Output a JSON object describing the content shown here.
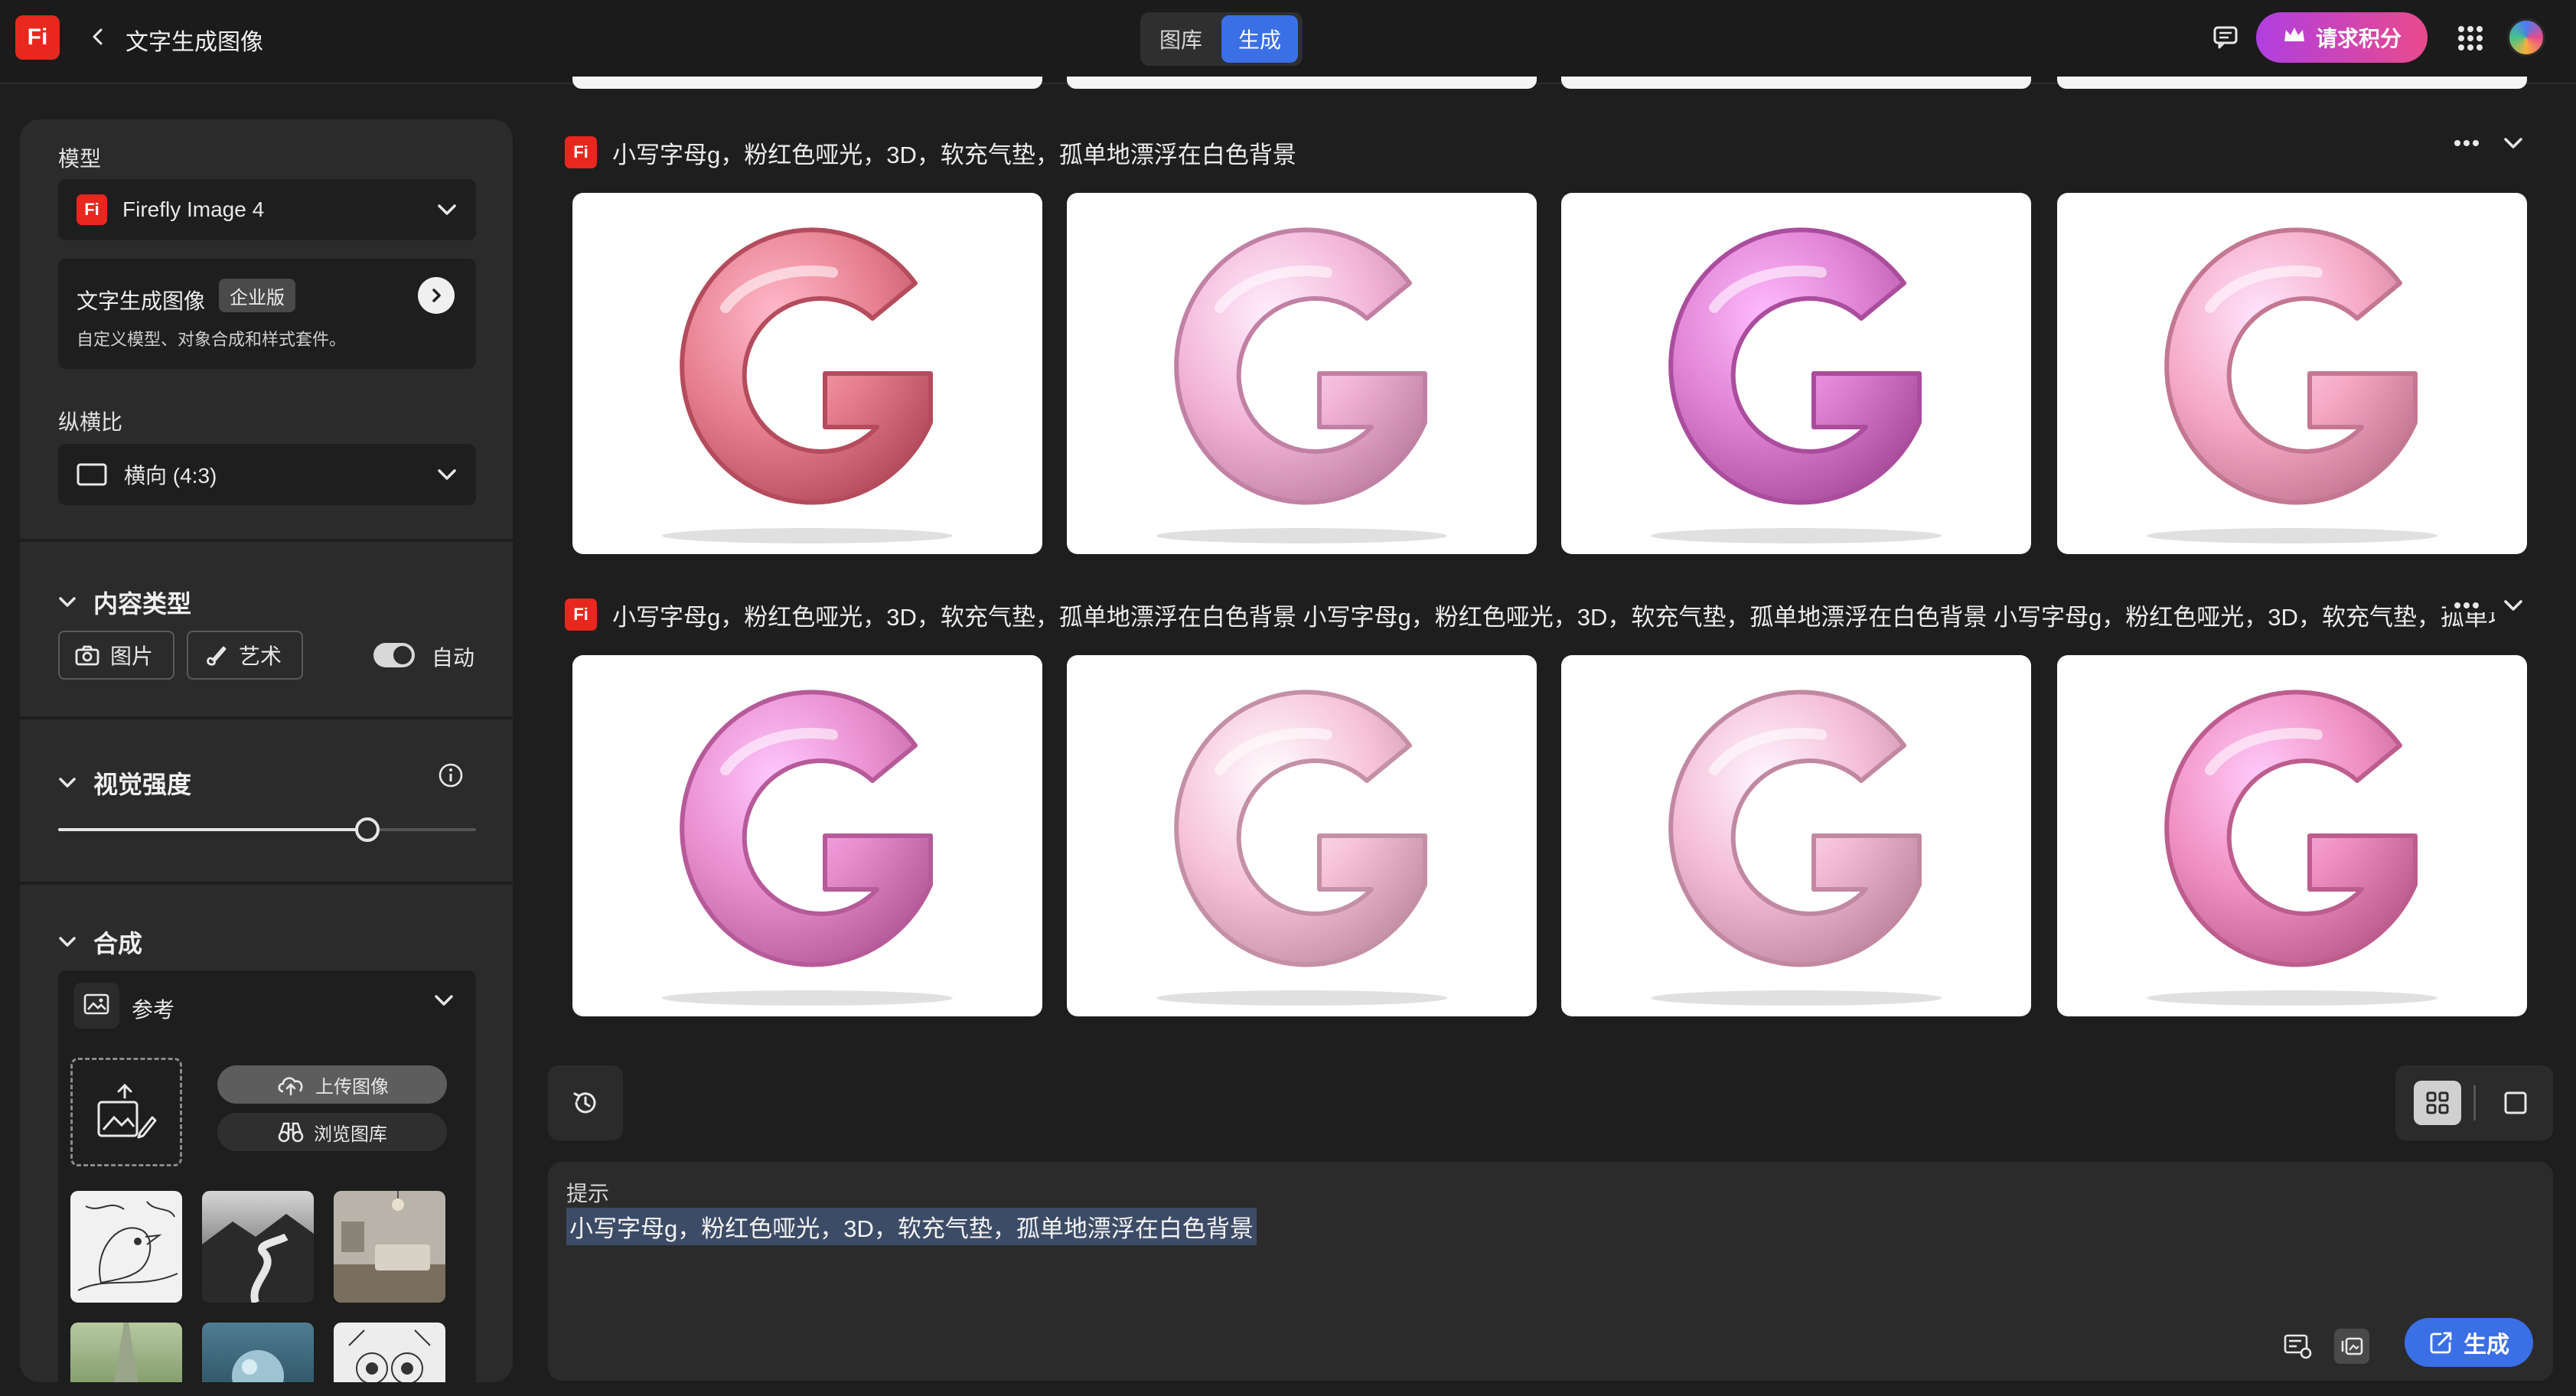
{
  "header": {
    "logo": "Fi",
    "title": "文字生成图像",
    "tabs": [
      "图库",
      "生成"
    ],
    "active_tab": "生成",
    "credits_button": "请求积分"
  },
  "sidebar": {
    "model_label": "模型",
    "model_value": "Firefly Image 4",
    "promo": {
      "title": "文字生成图像",
      "badge": "企业版",
      "subtitle": "自定义模型、对象合成和样式套件。"
    },
    "aspect_label": "纵横比",
    "aspect_value": "横向 (4:3)",
    "content_type": {
      "title": "内容类型",
      "photo": "图片",
      "art": "艺术",
      "auto": "自动",
      "auto_on": true
    },
    "visual_intensity": {
      "title": "视觉强度",
      "level": 0.74
    },
    "composition": {
      "title": "合成",
      "reference_label": "参考",
      "upload_button": "上传图像",
      "browse_button": "浏览图库"
    }
  },
  "gallery": {
    "rows": [
      {
        "prompt": "小写字母g，粉红色哑光，3D，软充气垫，孤单地漂浮在白色背景",
        "colors": [
          "#e67e8f",
          "#f2b3d6",
          "#dd7fcf",
          "#f5a9c4"
        ]
      },
      {
        "prompt": "小写字母g，粉红色哑光，3D，软充气垫，孤单地漂浮在白色背景 小写字母g，粉红色哑光，3D，软充气垫，孤单地漂浮在白色背景 小写字母g，粉红色哑光，3D，软充气垫，孤单地漂浮在白色背景",
        "colors": [
          "#e88ccc",
          "#f6c2d8",
          "#f3bad3",
          "#ef8fc0"
        ]
      }
    ]
  },
  "prompt_box": {
    "label": "提示",
    "value": "小写字母g，粉红色哑光，3D，软充气垫，孤单地漂浮在白色背景",
    "generate_button": "生成"
  },
  "colors": {
    "accent": "#3a6fe6",
    "brand": "#e8281e",
    "background": "#1e1e1e",
    "panel": "#2b2b2b"
  }
}
